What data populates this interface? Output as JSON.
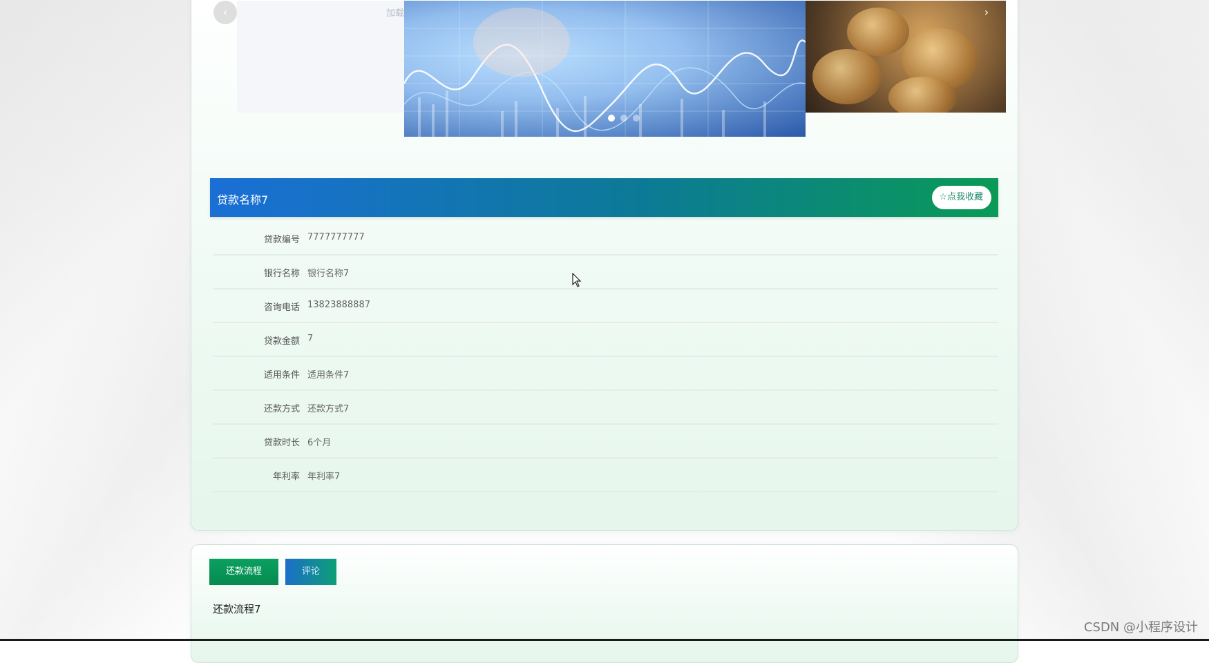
{
  "carousel": {
    "left_slide_text": "加载",
    "prev_icon": "chevron-left-icon",
    "next_icon": "chevron-right-icon",
    "next_glyph": "›",
    "prev_glyph": "‹",
    "slides_count": 3,
    "active_index": 0
  },
  "loan": {
    "title": "贷款名称7",
    "favorite_label": "☆点我收藏",
    "fields": [
      {
        "label": "贷款编号",
        "value": "7777777777"
      },
      {
        "label": "银行名称",
        "value": "银行名称7"
      },
      {
        "label": "咨询电话",
        "value": "13823888887"
      },
      {
        "label": "贷款金额",
        "value": "7"
      },
      {
        "label": "适用条件",
        "value": "适用条件7"
      },
      {
        "label": "还款方式",
        "value": "还款方式7"
      },
      {
        "label": "贷款时长",
        "value": "6个月"
      },
      {
        "label": "年利率",
        "value": "年利率7"
      }
    ]
  },
  "tabs": {
    "items": [
      {
        "label": "还款流程",
        "active": true
      },
      {
        "label": "评论",
        "active": false
      }
    ],
    "content": "还款流程7"
  },
  "watermark": "CSDN @小程序设计"
}
